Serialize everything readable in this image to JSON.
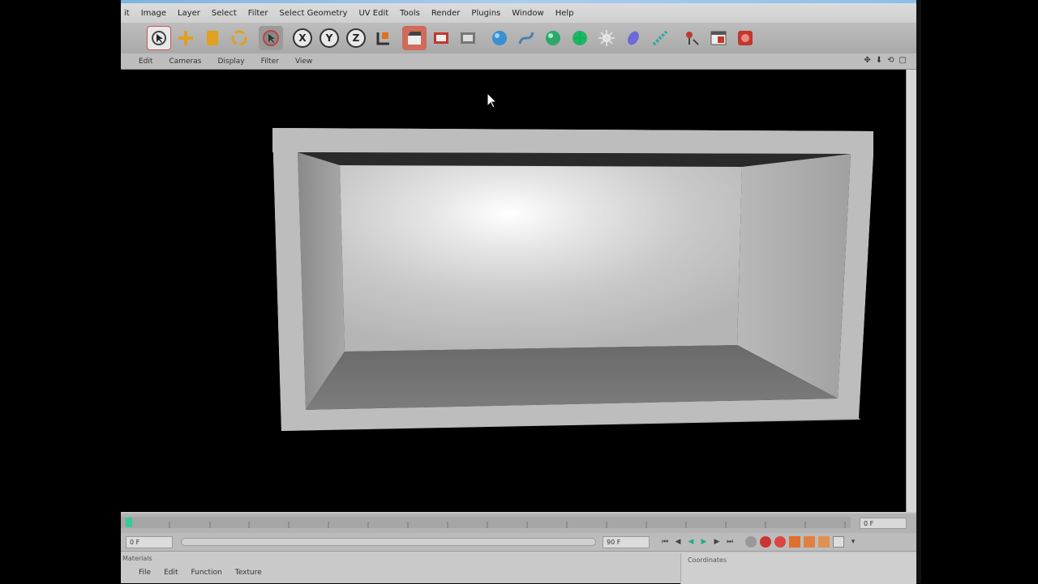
{
  "menubar": {
    "items": [
      "it",
      "Image",
      "Layer",
      "Select",
      "Filter",
      "Select Geometry",
      "UV Edit",
      "Tools",
      "Render",
      "Plugins",
      "Window",
      "Help"
    ]
  },
  "viewbar": {
    "items": [
      "Edit",
      "Cameras",
      "Display",
      "Filter",
      "View"
    ],
    "nav_icons": [
      "✥",
      "⬇",
      "⟲",
      "▢"
    ]
  },
  "toolbar": {
    "axis_labels": [
      "X",
      "Y",
      "Z"
    ]
  },
  "timeline": {
    "current_frame": "0 F"
  },
  "controls": {
    "start_field": "0 F",
    "range_field": "0 F",
    "end_field": "90 F"
  },
  "bottom": {
    "panel_label": "Materials",
    "menu": [
      "File",
      "Edit",
      "Function",
      "Texture"
    ],
    "coords_label": "Coordinates"
  },
  "colors": {
    "viewport_bg": "#000000",
    "ui_gray": "#c7c7c7",
    "accent_red": "#c0392b",
    "accent_orange": "#e0a020",
    "accent_green": "#2ecc71"
  }
}
